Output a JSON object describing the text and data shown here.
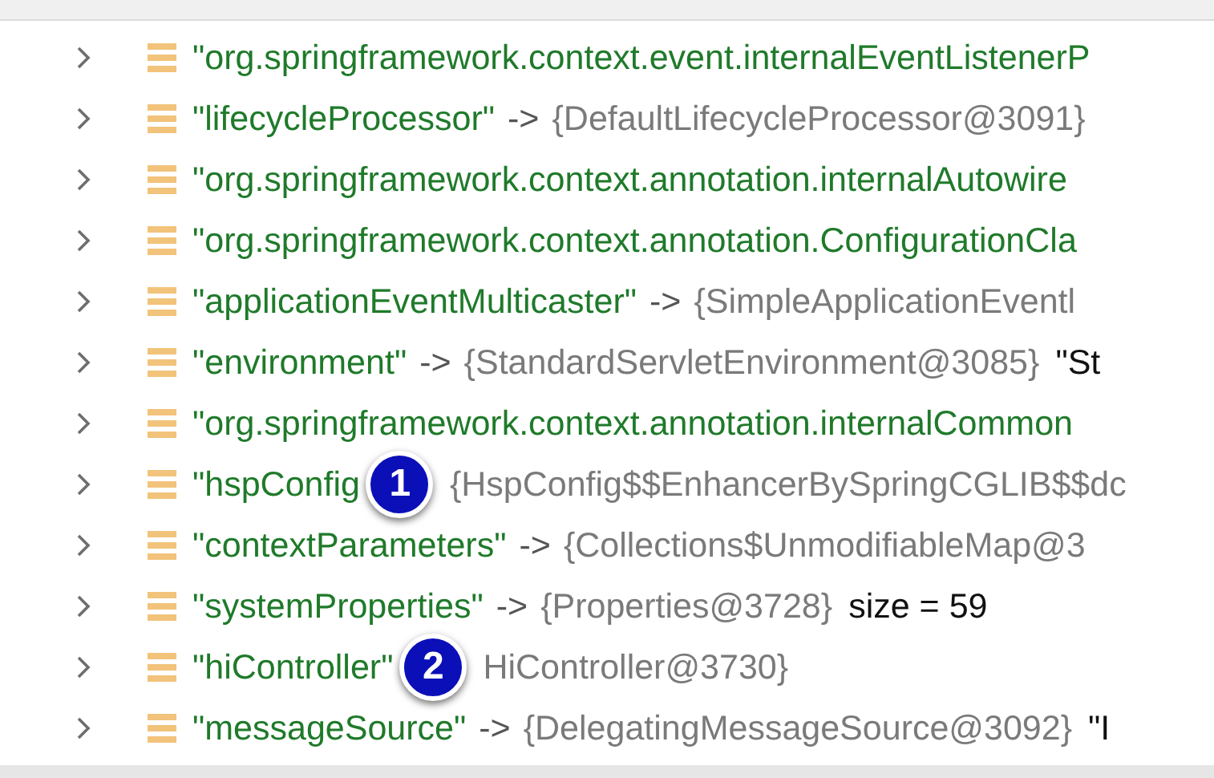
{
  "rows": [
    {
      "key": "\"org.springframework.context.event.internalEventListenerP"
    },
    {
      "key": "\"lifecycleProcessor\"",
      "arrow": "->",
      "value": "{DefaultLifecycleProcessor@3091}"
    },
    {
      "key": "\"org.springframework.context.annotation.internalAutowire"
    },
    {
      "key": "\"org.springframework.context.annotation.ConfigurationCla"
    },
    {
      "key": "\"applicationEventMulticaster\"",
      "arrow": "->",
      "value": "{SimpleApplicationEventl"
    },
    {
      "key": "\"environment\"",
      "arrow": "->",
      "value": "{StandardServletEnvironment@3085}",
      "extra": "\"St"
    },
    {
      "key": "\"org.springframework.context.annotation.internalCommon"
    },
    {
      "key": "\"hspConfig",
      "badge": "1",
      "value": "{HspConfig$$EnhancerBySpringCGLIB$$dc"
    },
    {
      "key": "\"contextParameters\"",
      "arrow": "->",
      "value": "{Collections$UnmodifiableMap@3"
    },
    {
      "key": "\"systemProperties\"",
      "arrow": "->",
      "value": "{Properties@3728}",
      "extra": "size = 59"
    },
    {
      "key": "\"hiController\"",
      "badge": "2",
      "value": "HiController@3730}"
    },
    {
      "key": "\"messageSource\"",
      "arrow": "->",
      "value": "{DelegatingMessageSource@3092}",
      "extra": "\"I"
    }
  ]
}
